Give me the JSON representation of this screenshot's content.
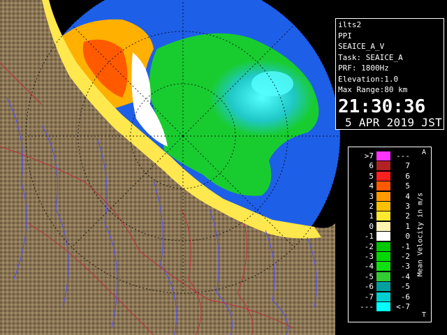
{
  "info_panel": {
    "site": "ilts2",
    "scan_type": "PPI",
    "product": "SEAICE_A_V",
    "task": "Task: SEAICE_A",
    "prf": "PRF: 1800Hz",
    "elevation": "Elevation:1.0",
    "max_range": "Max Range:80 km",
    "time": "21:30:36",
    "date": "5 APR 2019 JST"
  },
  "legend": {
    "title": "Mean Velocity in m/s",
    "top_marker": "A",
    "bottom_marker": "T",
    "rows": [
      {
        "left": ">7",
        "right": "---",
        "color": "#ff33ff"
      },
      {
        "left": "6",
        "right": "7",
        "color": "#b22222"
      },
      {
        "left": "5",
        "right": "6",
        "color": "#ff2020"
      },
      {
        "left": "4",
        "right": "5",
        "color": "#ff5a00"
      },
      {
        "left": "3",
        "right": "4",
        "color": "#ff9a00"
      },
      {
        "left": "2",
        "right": "3",
        "color": "#ffc000"
      },
      {
        "left": "1",
        "right": "2",
        "color": "#ffea30"
      },
      {
        "left": "0",
        "right": "1",
        "color": "#fff3b0"
      },
      {
        "left": "-1",
        "right": "0",
        "color": "#ffffff"
      },
      {
        "left": "-2",
        "right": "-1",
        "color": "#00c800"
      },
      {
        "left": "-3",
        "right": "-2",
        "color": "#00d800"
      },
      {
        "left": "-4",
        "right": "-3",
        "color": "#10e010"
      },
      {
        "left": "-5",
        "right": "-4",
        "color": "#33cc33"
      },
      {
        "left": "-6",
        "right": "-5",
        "color": "#00a0a0"
      },
      {
        "left": "-7",
        "right": "-6",
        "color": "#00d0d0"
      },
      {
        "left": "---",
        "right": "<-7",
        "color": "#00ffff"
      }
    ]
  },
  "colors": {
    "sea_echo": "#1e5fe8",
    "land": "#8a7656",
    "coast_echo": "#ffe84d",
    "river": "#5050ff",
    "border": "#c03040"
  }
}
